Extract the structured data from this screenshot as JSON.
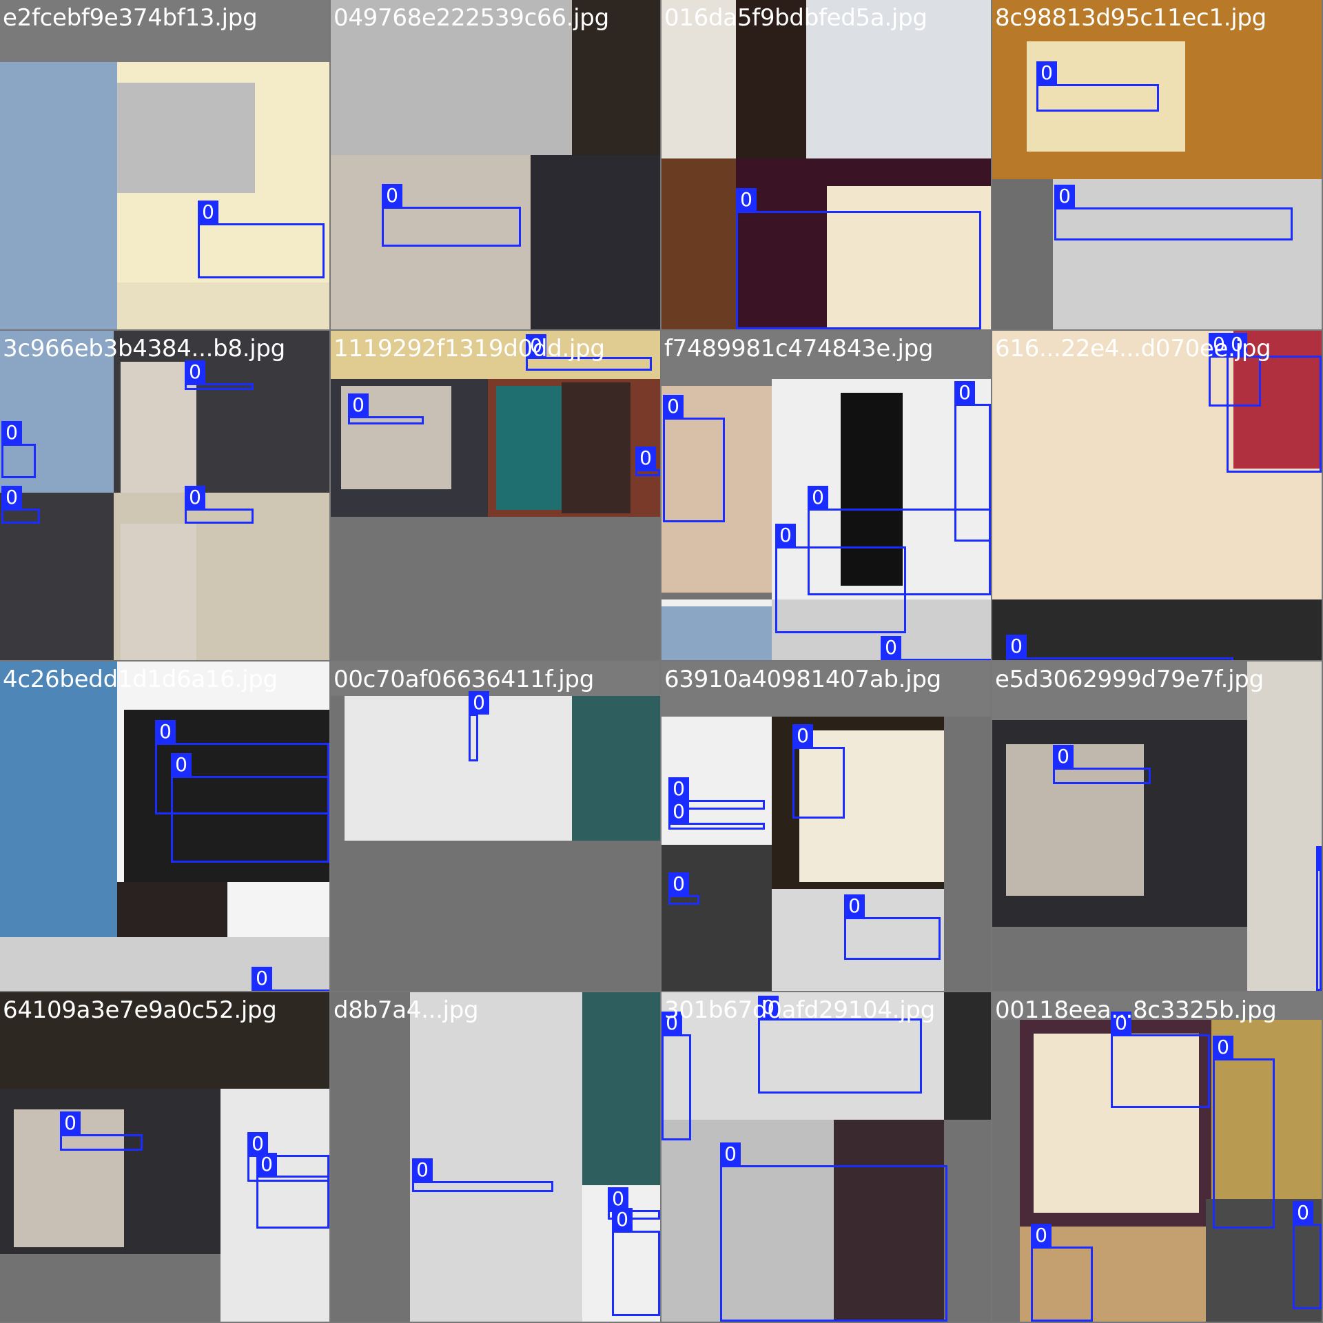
{
  "colors": {
    "box": "#1a2cff",
    "label_text": "#ffffff",
    "filename_text": "#ffffff",
    "padding": "#727272"
  },
  "tiles": [
    {
      "name": "e2fcebf9e374bf13.jpg",
      "labels": [
        "0"
      ]
    },
    {
      "name": "049768e222539c66.jpg",
      "labels": [
        "0"
      ]
    },
    {
      "name": "016da5f9bdbfed5a.jpg",
      "labels": [
        "0"
      ]
    },
    {
      "name": "8c98813d95c11ec1.jpg",
      "labels": [
        "0",
        "0"
      ]
    },
    {
      "name": "3c966eb3b4384...b8.jpg",
      "labels": [
        "0",
        "0",
        "0",
        "0"
      ]
    },
    {
      "name": "1119292f1319d0dd.jpg",
      "labels": [
        "0",
        "0",
        "0"
      ]
    },
    {
      "name": "f7489981c474843e.jpg",
      "labels": [
        "0",
        "0",
        "0",
        "0",
        "0"
      ]
    },
    {
      "name": "616...22e4...d070ee.jpg",
      "labels": [
        "0",
        "0",
        "0"
      ]
    },
    {
      "name": "4c26bedd1d1d6a16.jpg",
      "labels": [
        "0",
        "0",
        "0"
      ]
    },
    {
      "name": "00c70af06636411f.jpg",
      "labels": [
        "0"
      ]
    },
    {
      "name": "63910a40981407ab.jpg",
      "labels": [
        "0",
        "0",
        "0",
        "0",
        "0"
      ]
    },
    {
      "name": "e5d3062999d79e7f.jpg",
      "labels": [
        "0",
        "0"
      ]
    },
    {
      "name": "64109a3e7e9a0c52.jpg",
      "labels": [
        "0",
        "0",
        "0"
      ]
    },
    {
      "name": "d8b7a4...jpg",
      "labels": [
        "0",
        "0",
        "0"
      ]
    },
    {
      "name": "301b67d0afd29104.jpg",
      "labels": [
        "0",
        "0",
        "0"
      ]
    },
    {
      "name": "00118eea...8c3325b.jpg",
      "labels": [
        "0",
        "0",
        "0",
        "0"
      ]
    }
  ]
}
